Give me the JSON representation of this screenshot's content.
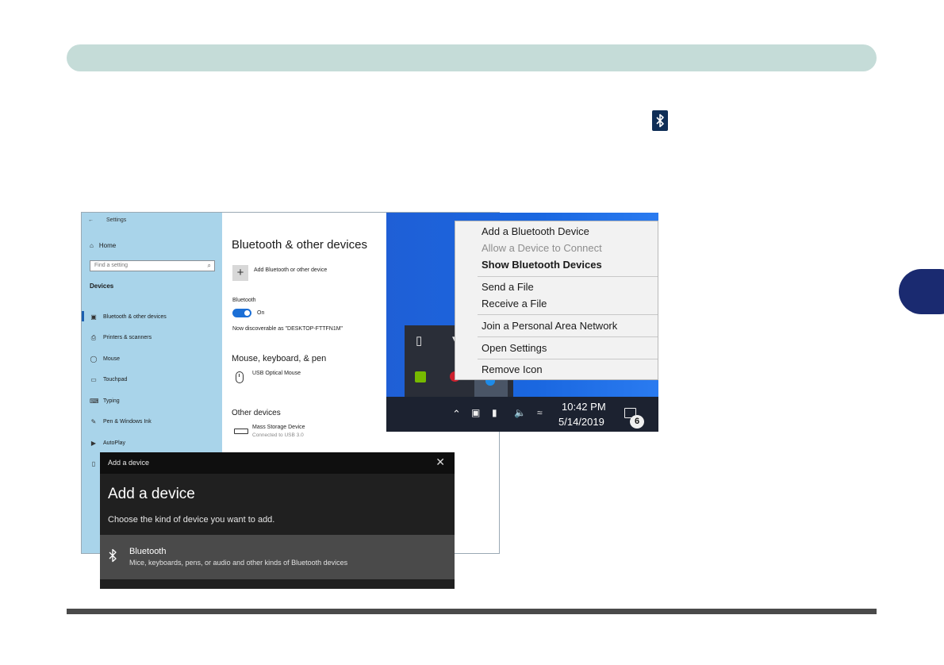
{
  "settings": {
    "title": "Settings",
    "home": "Home",
    "search_placeholder": "Find a setting",
    "section": "Devices",
    "nav": [
      {
        "icon": "bluetooth-devices-icon",
        "label": "Bluetooth & other devices"
      },
      {
        "icon": "printer-icon",
        "label": "Printers & scanners"
      },
      {
        "icon": "mouse-icon",
        "label": "Mouse"
      },
      {
        "icon": "touchpad-icon",
        "label": "Touchpad"
      },
      {
        "icon": "keyboard-icon",
        "label": "Typing"
      },
      {
        "icon": "pen-icon",
        "label": "Pen & Windows Ink"
      },
      {
        "icon": "autoplay-icon",
        "label": "AutoPlay"
      },
      {
        "icon": "usb-icon",
        "label": ""
      }
    ],
    "heading": "Bluetooth & other devices",
    "add_label": "Add Bluetooth or other device",
    "bluetooth_label": "Bluetooth",
    "toggle_state": "On",
    "discoverable": "Now discoverable as \"DESKTOP-FTTFN1M\"",
    "mkp_heading": "Mouse, keyboard, & pen",
    "mouse_device": "USB Optical Mouse",
    "other_heading": "Other devices",
    "other_device": "Mass Storage Device",
    "other_status": "Connected to USB 3.0"
  },
  "dialog": {
    "titlebar": "Add a device",
    "heading": "Add a device",
    "subtitle": "Choose the kind of device you want to add.",
    "option_title": "Bluetooth",
    "option_desc": "Mice, keyboards, pens, or audio and other kinds of Bluetooth devices"
  },
  "context_menu": {
    "items": [
      {
        "label": "Add a Bluetooth Device",
        "state": "normal"
      },
      {
        "label": "Allow a Device to Connect",
        "state": "disabled"
      },
      {
        "label": "Show Bluetooth Devices",
        "state": "bold"
      },
      {
        "label": "Send a File",
        "state": "normal"
      },
      {
        "label": "Receive a File",
        "state": "normal"
      },
      {
        "label": "Join a Personal Area Network",
        "state": "normal"
      },
      {
        "label": "Open Settings",
        "state": "normal"
      },
      {
        "label": "Remove Icon",
        "state": "normal"
      }
    ]
  },
  "taskbar": {
    "time": "10:42 PM",
    "date": "5/14/2019",
    "notification_count": "6"
  },
  "colors": {
    "header_bar": "#c5dcd8",
    "side_tab": "#1a2a70",
    "footer_rule": "#4a4a4a",
    "settings_sidebar": "#a9d4ea",
    "accent": "#1b6fd6"
  }
}
